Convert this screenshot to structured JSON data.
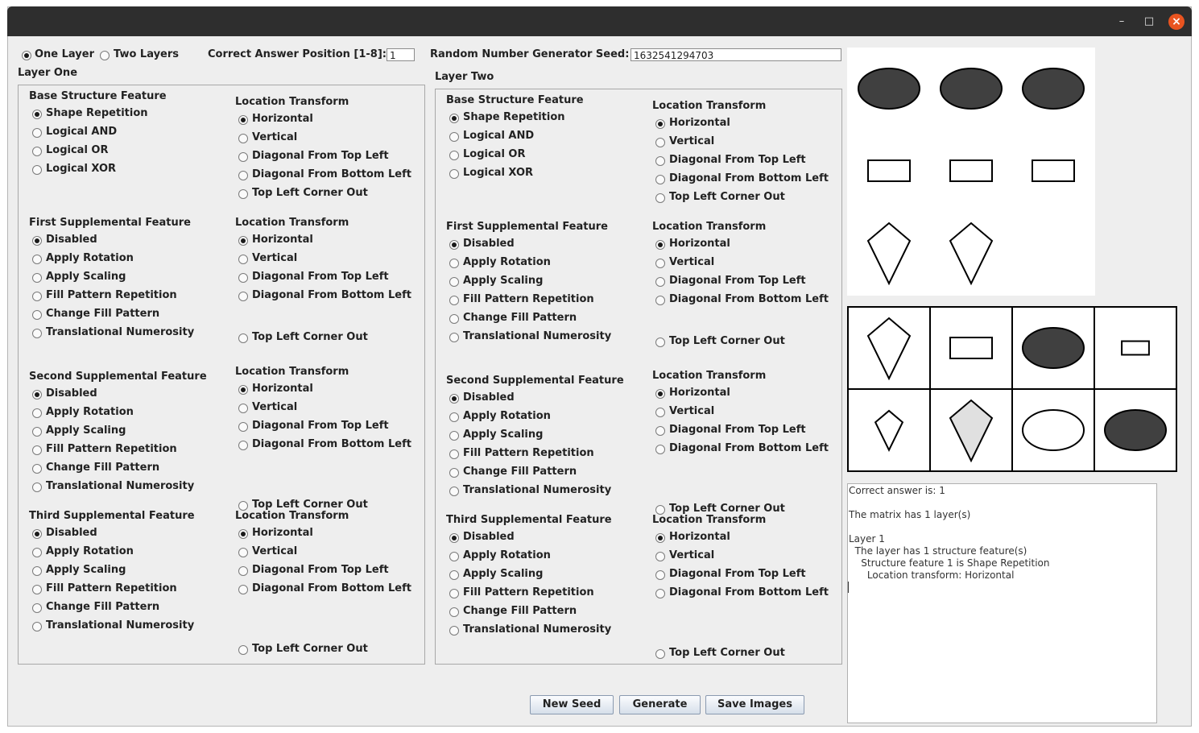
{
  "window": {
    "controls": {
      "minimize": "–",
      "maximize": "□",
      "close": "×"
    }
  },
  "top_bar": {
    "one_layer": "One Layer",
    "two_layers": "Two Layers",
    "correct_answer_label": "Correct Answer Position [1-8]:",
    "correct_answer_value": "1",
    "seed_label": "Random Number Generator Seed:",
    "seed_value": "1632541294703"
  },
  "layers": [
    {
      "title": "Layer One",
      "groups": [
        {
          "title": "Base Structure Feature",
          "options": [
            "Shape Repetition",
            "Logical AND",
            "Logical OR",
            "Logical XOR"
          ],
          "selected": 0,
          "transform_title": "Location Transform",
          "transforms": [
            "Horizontal",
            "Vertical",
            "Diagonal From Top Left",
            "Diagonal From Bottom Left",
            "Top Left Corner Out"
          ],
          "transform_selected": 0
        },
        {
          "title": "First Supplemental Feature",
          "options": [
            "Disabled",
            "Apply Rotation",
            "Apply Scaling",
            "Fill Pattern Repetition",
            "Change Fill Pattern",
            "Translational Numerosity"
          ],
          "selected": 0,
          "transform_title": "Location Transform",
          "transforms": [
            "Horizontal",
            "Vertical",
            "Diagonal From Top Left",
            "Diagonal From Bottom Left",
            "Top Left Corner Out"
          ],
          "transform_selected": 0
        },
        {
          "title": "Second Supplemental Feature",
          "options": [
            "Disabled",
            "Apply Rotation",
            "Apply Scaling",
            "Fill Pattern Repetition",
            "Change Fill Pattern",
            "Translational Numerosity"
          ],
          "selected": 0,
          "transform_title": "Location Transform",
          "transforms": [
            "Horizontal",
            "Vertical",
            "Diagonal From Top Left",
            "Diagonal From Bottom Left",
            "Top Left Corner Out"
          ],
          "transform_selected": 0
        },
        {
          "title": "Third Supplemental Feature",
          "options": [
            "Disabled",
            "Apply Rotation",
            "Apply Scaling",
            "Fill Pattern Repetition",
            "Change Fill Pattern",
            "Translational Numerosity"
          ],
          "selected": 0,
          "transform_title": "Location Transform",
          "transforms": [
            "Horizontal",
            "Vertical",
            "Diagonal From Top Left",
            "Diagonal From Bottom Left",
            "Top Left Corner Out"
          ],
          "transform_selected": 0
        }
      ]
    },
    {
      "title": "Layer Two",
      "groups": [
        {
          "title": "Base Structure Feature",
          "options": [
            "Shape Repetition",
            "Logical AND",
            "Logical OR",
            "Logical XOR"
          ],
          "selected": 0,
          "transform_title": "Location Transform",
          "transforms": [
            "Horizontal",
            "Vertical",
            "Diagonal From Top Left",
            "Diagonal From Bottom Left",
            "Top Left Corner Out"
          ],
          "transform_selected": 0
        },
        {
          "title": "First Supplemental Feature",
          "options": [
            "Disabled",
            "Apply Rotation",
            "Apply Scaling",
            "Fill Pattern Repetition",
            "Change Fill Pattern",
            "Translational Numerosity"
          ],
          "selected": 0,
          "transform_title": "Location Transform",
          "transforms": [
            "Horizontal",
            "Vertical",
            "Diagonal From Top Left",
            "Diagonal From Bottom Left",
            "Top Left Corner Out"
          ],
          "transform_selected": 0
        },
        {
          "title": "Second Supplemental Feature",
          "options": [
            "Disabled",
            "Apply Rotation",
            "Apply Scaling",
            "Fill Pattern Repetition",
            "Change Fill Pattern",
            "Translational Numerosity"
          ],
          "selected": 0,
          "transform_title": "Location Transform",
          "transforms": [
            "Horizontal",
            "Vertical",
            "Diagonal From Top Left",
            "Diagonal From Bottom Left",
            "Top Left Corner Out"
          ],
          "transform_selected": 0
        },
        {
          "title": "Third Supplemental Feature",
          "options": [
            "Disabled",
            "Apply Rotation",
            "Apply Scaling",
            "Fill Pattern Repetition",
            "Change Fill Pattern",
            "Translational Numerosity"
          ],
          "selected": 0,
          "transform_title": "Location Transform",
          "transforms": [
            "Horizontal",
            "Vertical",
            "Diagonal From Top Left",
            "Diagonal From Bottom Left",
            "Top Left Corner Out"
          ],
          "transform_selected": 0
        }
      ]
    }
  ],
  "buttons": {
    "new_seed": "New Seed",
    "generate": "Generate",
    "save_images": "Save Images"
  },
  "matrix": {
    "cells": [
      {
        "shape": "ellipse",
        "fill": "#404040"
      },
      {
        "shape": "ellipse",
        "fill": "#404040"
      },
      {
        "shape": "ellipse",
        "fill": "#404040"
      },
      {
        "shape": "rectangle",
        "fill": "#ffffff"
      },
      {
        "shape": "rectangle",
        "fill": "#ffffff"
      },
      {
        "shape": "rectangle",
        "fill": "#ffffff"
      },
      {
        "shape": "kite",
        "fill": "#ffffff"
      },
      {
        "shape": "kite",
        "fill": "#ffffff"
      },
      {
        "shape": "empty",
        "fill": "#ffffff"
      }
    ]
  },
  "answers": [
    {
      "shape": "kite",
      "fill": "#ffffff",
      "scale": "large"
    },
    {
      "shape": "rectangle",
      "fill": "#ffffff",
      "scale": "large"
    },
    {
      "shape": "ellipse",
      "fill": "#404040",
      "scale": "large"
    },
    {
      "shape": "rectangle",
      "fill": "#ffffff",
      "scale": "small"
    },
    {
      "shape": "kite",
      "fill": "#ffffff",
      "scale": "small"
    },
    {
      "shape": "kite",
      "fill": "#e0e0e0",
      "scale": "large"
    },
    {
      "shape": "ellipse",
      "fill": "#ffffff",
      "scale": "large"
    },
    {
      "shape": "ellipse",
      "fill": "#404040",
      "scale": "large"
    }
  ],
  "output_lines": [
    "Correct answer is: 1",
    "",
    "The matrix has 1 layer(s)",
    "",
    "Layer 1",
    "  The layer has 1 structure feature(s)",
    "    Structure feature 1 is Shape Repetition",
    "      Location transform: Horizontal"
  ]
}
